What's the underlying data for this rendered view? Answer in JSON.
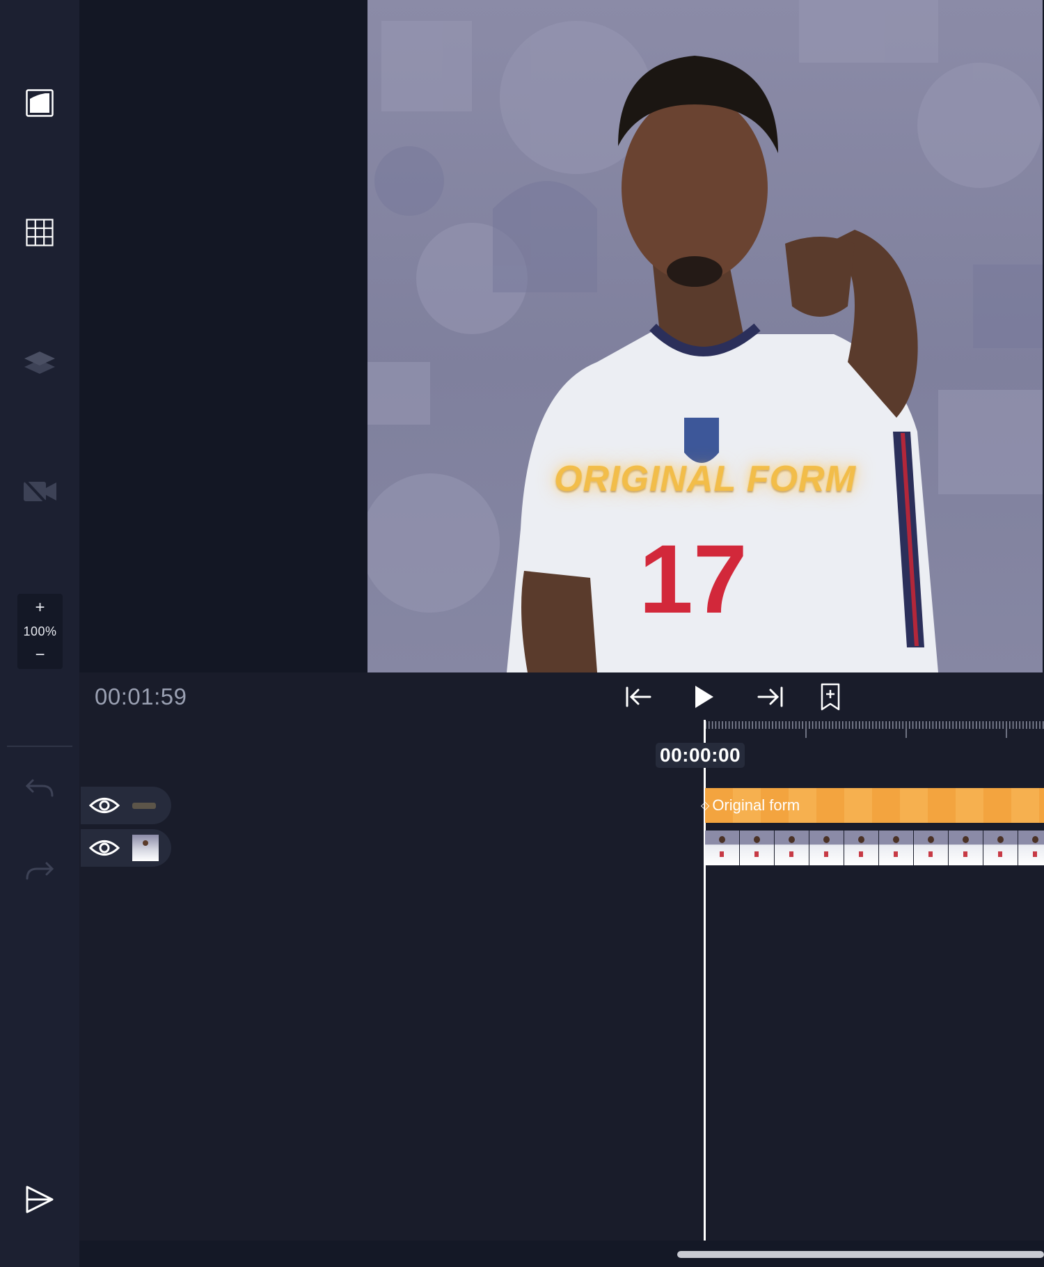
{
  "sidebar": {
    "tools": [
      {
        "name": "aspect-ratio-icon"
      },
      {
        "name": "grid-icon"
      },
      {
        "name": "layers-icon"
      },
      {
        "name": "camera-off-icon"
      }
    ],
    "zoom": {
      "plus": "+",
      "value": "100%",
      "minus": "−"
    },
    "undo_icon": "undo-icon",
    "redo_icon": "redo-icon",
    "export_icon": "export-icon"
  },
  "preview": {
    "overlay_text": "ORIGINAL FORM",
    "overlay_color": "#f2bd49"
  },
  "transport": {
    "current_time": "00:01:59",
    "buttons": [
      "skip-to-start-icon",
      "play-icon",
      "skip-to-end-icon",
      "add-bookmark-icon"
    ]
  },
  "timeline": {
    "playhead_time": "00:00:00",
    "tracks": [
      {
        "type": "text",
        "clip_label": "Original form",
        "clip_color": "#f3a43f"
      },
      {
        "type": "video"
      }
    ]
  }
}
